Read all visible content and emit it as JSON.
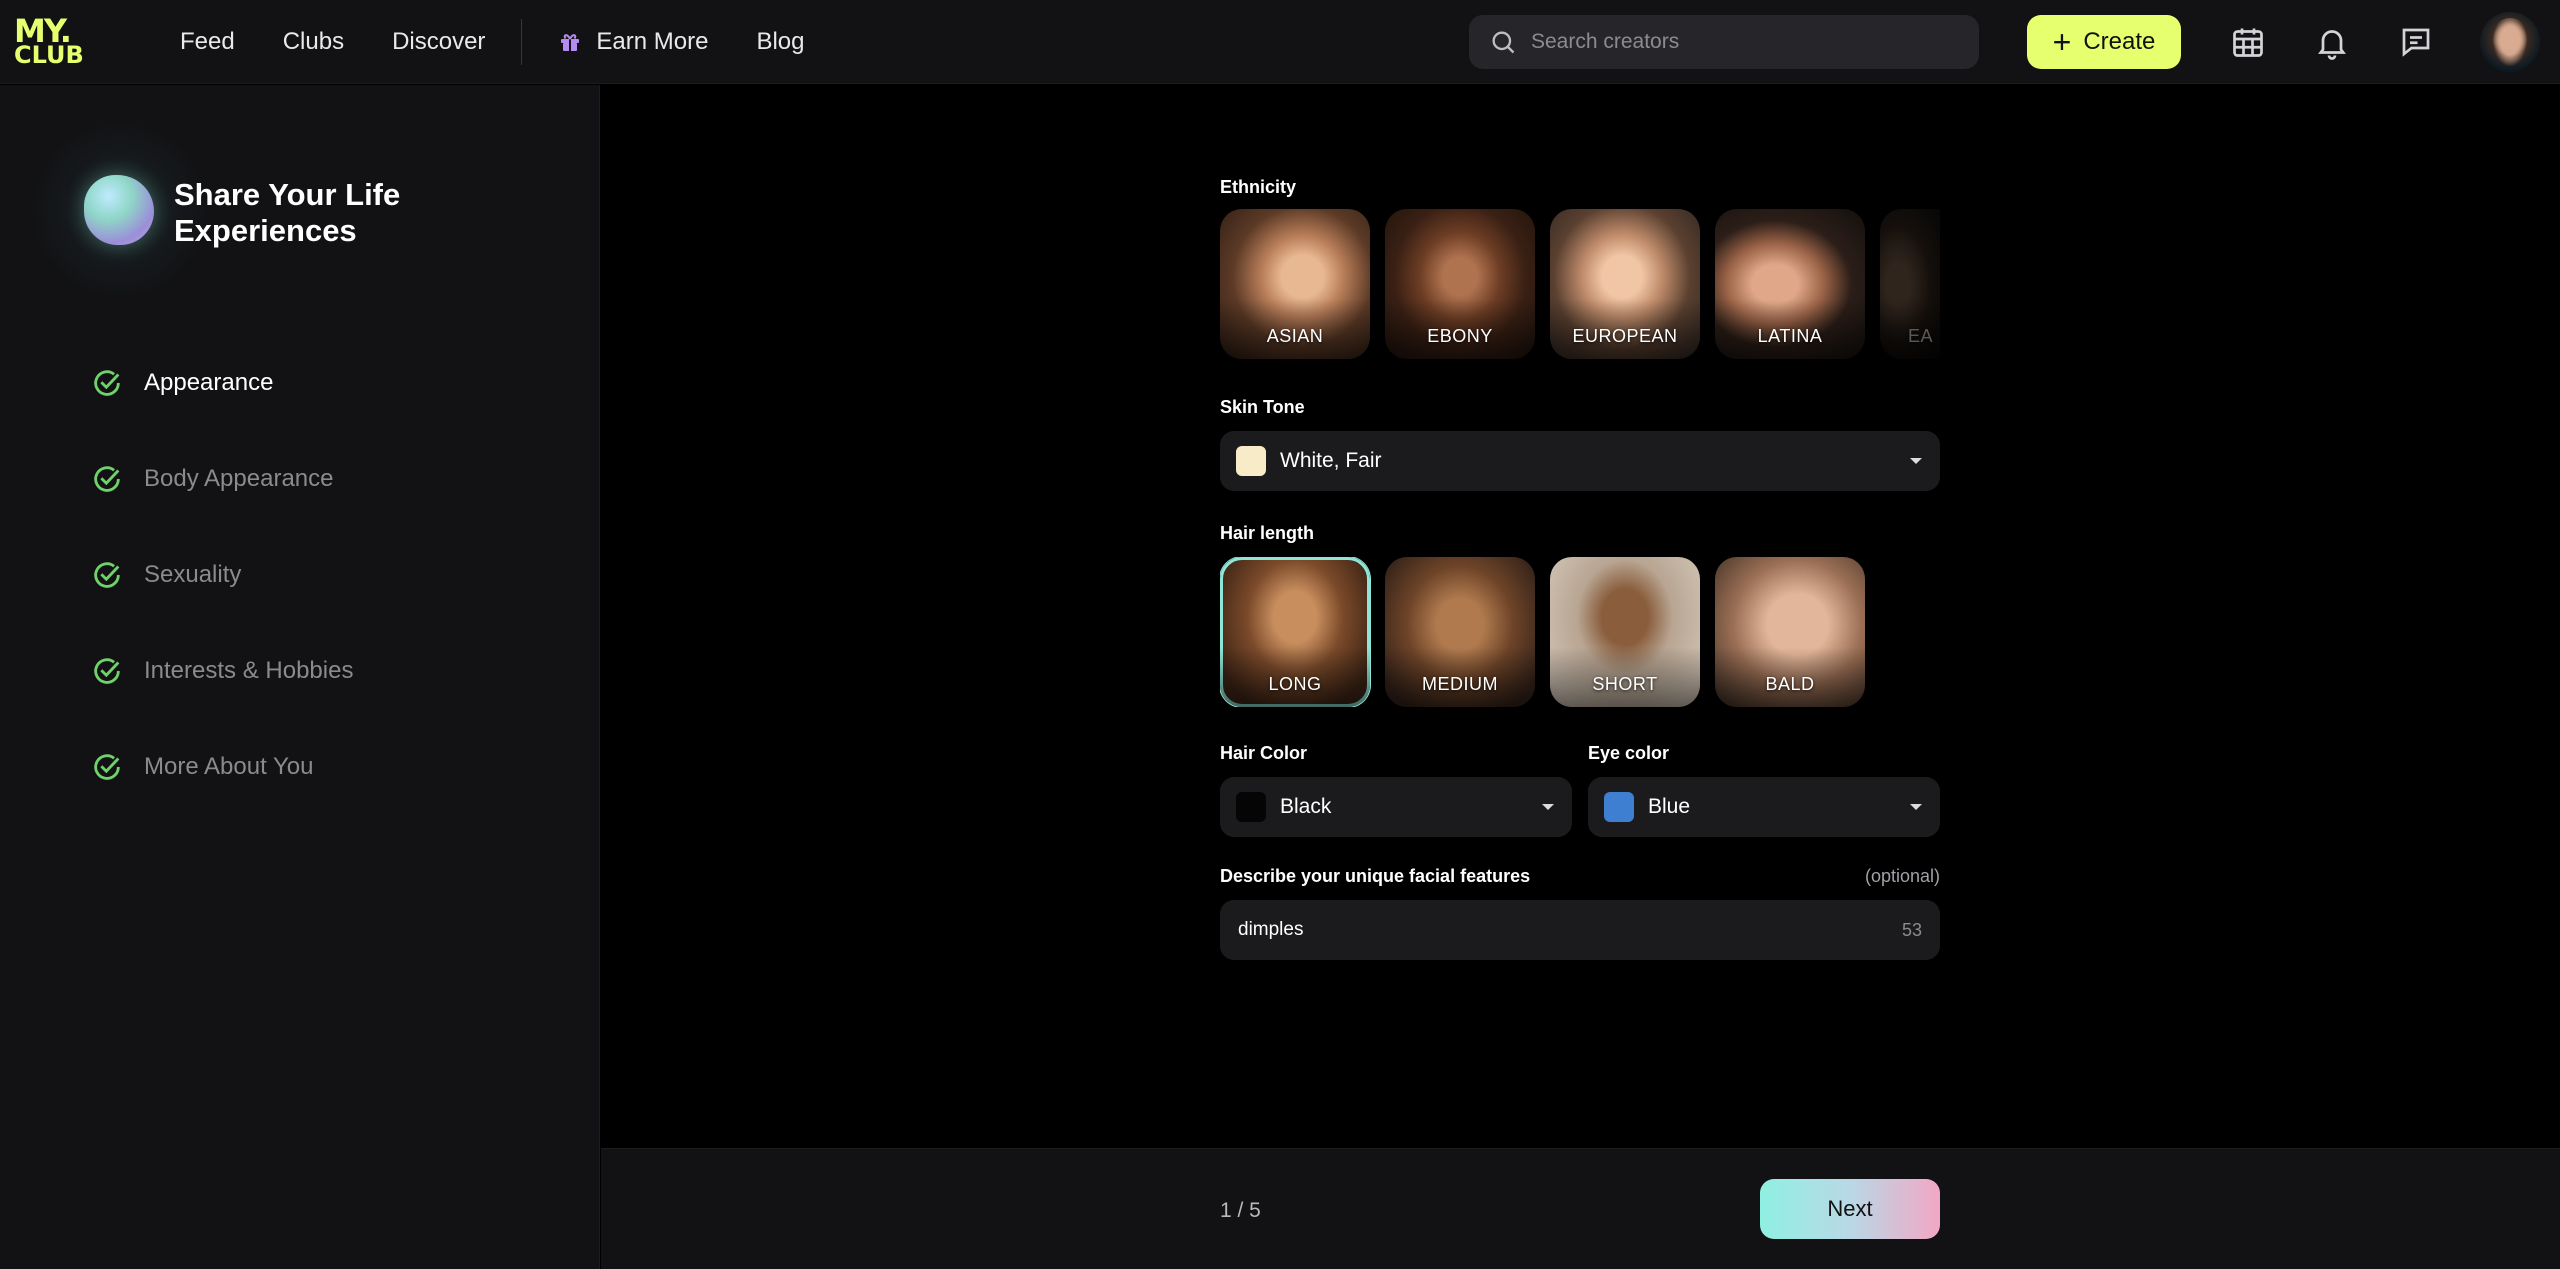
{
  "nav": {
    "logo_line1": "MY.",
    "logo_line2": "CLUB",
    "links": [
      "Feed",
      "Clubs",
      "Discover"
    ],
    "earn_label": "Earn More",
    "blog_label": "Blog",
    "search_placeholder": "Search creators",
    "create_label": "Create"
  },
  "sidebar": {
    "title": "Share Your Life Experiences",
    "steps": [
      {
        "label": "Appearance",
        "active": true
      },
      {
        "label": "Body Appearance",
        "active": false
      },
      {
        "label": "Sexuality",
        "active": false
      },
      {
        "label": "Interests & Hobbies",
        "active": false
      },
      {
        "label": "More About You",
        "active": false
      }
    ]
  },
  "form": {
    "ethnicity_label": "Ethnicity",
    "ethnicity_options": [
      "ASIAN",
      "EBONY",
      "EUROPEAN",
      "LATINA",
      "EA"
    ],
    "skin_tone_label": "Skin Tone",
    "skin_tone_value": "White, Fair",
    "skin_tone_color": "#f8ecc8",
    "hair_length_label": "Hair length",
    "hair_length_options": [
      "LONG",
      "MEDIUM",
      "SHORT",
      "BALD"
    ],
    "hair_length_selected": "LONG",
    "hair_color_label": "Hair Color",
    "hair_color_value": "Black",
    "hair_color_swatch": "#050505",
    "eye_color_label": "Eye color",
    "eye_color_value": "Blue",
    "eye_color_swatch": "#3f7fd1",
    "facial_label": "Describe your unique facial features",
    "facial_optional": "(optional)",
    "facial_value": "dimples",
    "facial_counter": "53"
  },
  "footer": {
    "pager": "1 / 5",
    "next_label": "Next"
  },
  "colors": {
    "accent": "#e6ff6e",
    "check_green": "#6ed36a",
    "selected_outline": "#8fe6d8"
  }
}
